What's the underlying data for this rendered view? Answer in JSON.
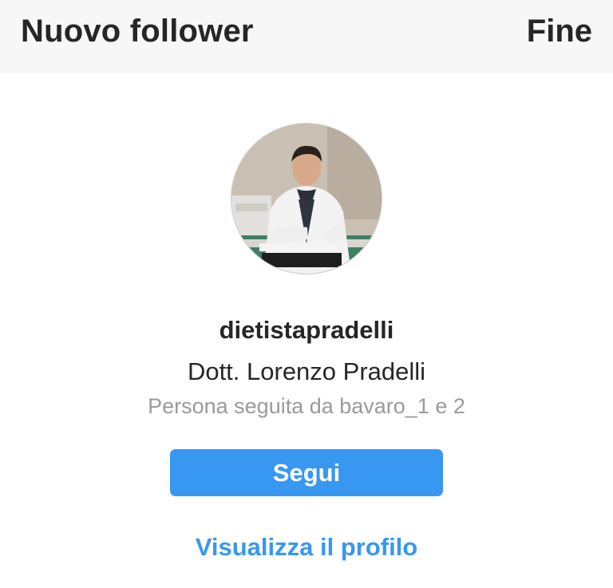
{
  "header": {
    "title": "Nuovo follower",
    "done_label": "Fine"
  },
  "profile": {
    "avatar_icon": "profile-photo",
    "username": "dietistapradelli",
    "full_name": "Dott. Lorenzo Pradelli",
    "followed_by": "Persona seguita da bavaro_1 e 2"
  },
  "actions": {
    "follow_label": "Segui",
    "view_profile_label": "Visualizza il profilo"
  },
  "colors": {
    "accent": "#3897f0",
    "header_bg": "#f7f7f7",
    "text_primary": "#262626",
    "text_secondary": "#9a9a9a"
  }
}
